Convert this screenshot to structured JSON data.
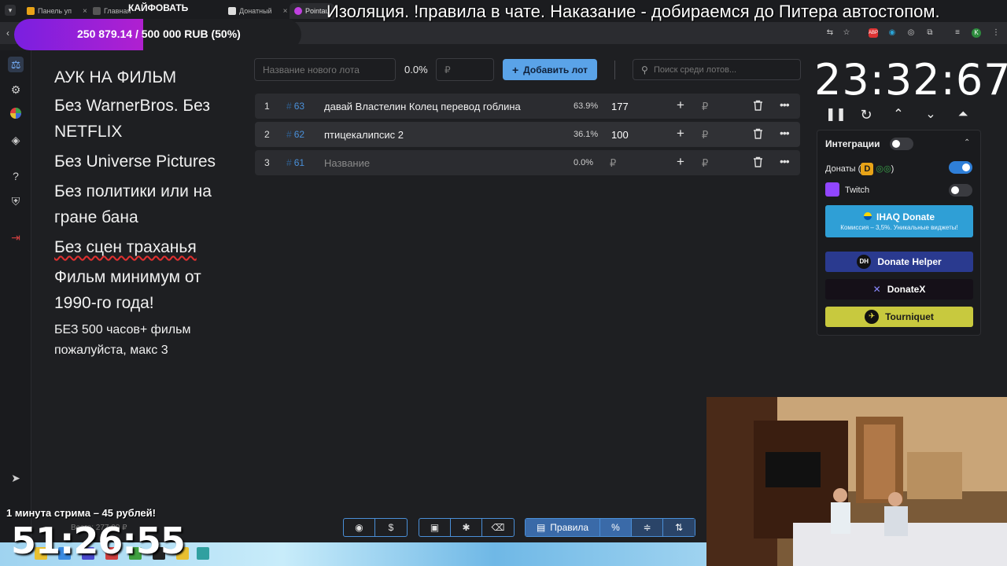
{
  "browser": {
    "tabs": [
      {
        "label": "Панель уп",
        "color": "#e8a317"
      },
      {
        "label": "Главная",
        "color": "#444"
      },
      {
        "label": "Донатный",
        "color": "#eee"
      },
      {
        "label": "Pointau",
        "color": "#c040e0"
      }
    ],
    "ext_icons": [
      "translate-icon",
      "star-icon",
      "abp-icon",
      "ext-icon",
      "ext-icon",
      "puzzle-icon",
      "list-icon",
      "download-icon",
      "profile-icon",
      "menu-icon"
    ],
    "profile_letter": "K"
  },
  "overlay": {
    "goal_title": "КАЙФОВАТЬ",
    "goal_progress": "250 879.14 / 500 000 RUB (50%)",
    "goal_fraction": 0.5,
    "ticker": "Изоляция. !правила в чате. Наказание - добираемся до Питера автостопом.",
    "stream_rate": "1 минута стрима – 45 рублей!",
    "stream_timer": "51:26:55",
    "total_line": "Всего: 277.00 ₽"
  },
  "rules": {
    "heading": "АУК НА ФИЛЬМ",
    "lines": [
      "Без WarnerBros. Без NETFLIX",
      "Без Universe Pictures",
      "Без политики или на гране бана",
      "Без сцен траханья",
      "Фильм минимум от 1990-го года!"
    ],
    "small": " БЕЗ 500 часов+ фильм пожалуйста, макс 3"
  },
  "controls": {
    "lot_name_placeholder": "Название нового лота",
    "percent": "0.0%",
    "amount_placeholder": "₽",
    "add_lot_label": "Добавить лот",
    "search_placeholder": "Поиск среди лотов..."
  },
  "lots": [
    {
      "index": "1",
      "id": "63",
      "name": "давай Властелин Колец перевод гоблина",
      "percent": "63.9%",
      "amount": "177",
      "empty": false
    },
    {
      "index": "2",
      "id": "62",
      "name": "птицекалипсис 2",
      "percent": "36.1%",
      "amount": "100",
      "empty": false
    },
    {
      "index": "3",
      "id": "61",
      "name": "Название",
      "percent": "0.0%",
      "amount": "₽",
      "empty": true
    }
  ],
  "lot_symbols": {
    "hash": "#",
    "plus": "+",
    "rub": "₽",
    "trash": "🗑",
    "more": "•••"
  },
  "timer": {
    "display": "23:32:67"
  },
  "integrations": {
    "title": "Интеграции",
    "donations_label": "Донаты (",
    "donations_close": ")",
    "donations_on": true,
    "twitch_label": "Twitch",
    "twitch_on": false,
    "ihaq_label": "IHAQ Donate",
    "ihaq_sub": "Комиссия – 3,5%. Уникальные виджеты!",
    "donate_helper": "Donate Helper",
    "donate_helper_logo": "DH",
    "donatex": "DonateX",
    "tourniquet": "Tourniquet"
  },
  "bottom": {
    "rules_label": "Правила"
  },
  "colors": {
    "accent": "#5aa3e8",
    "lot_id": "#4a90d9",
    "ihaq": "#2f9fd6",
    "donate_helper": "#2a3a8f",
    "tourniquet": "#c8c93e"
  }
}
